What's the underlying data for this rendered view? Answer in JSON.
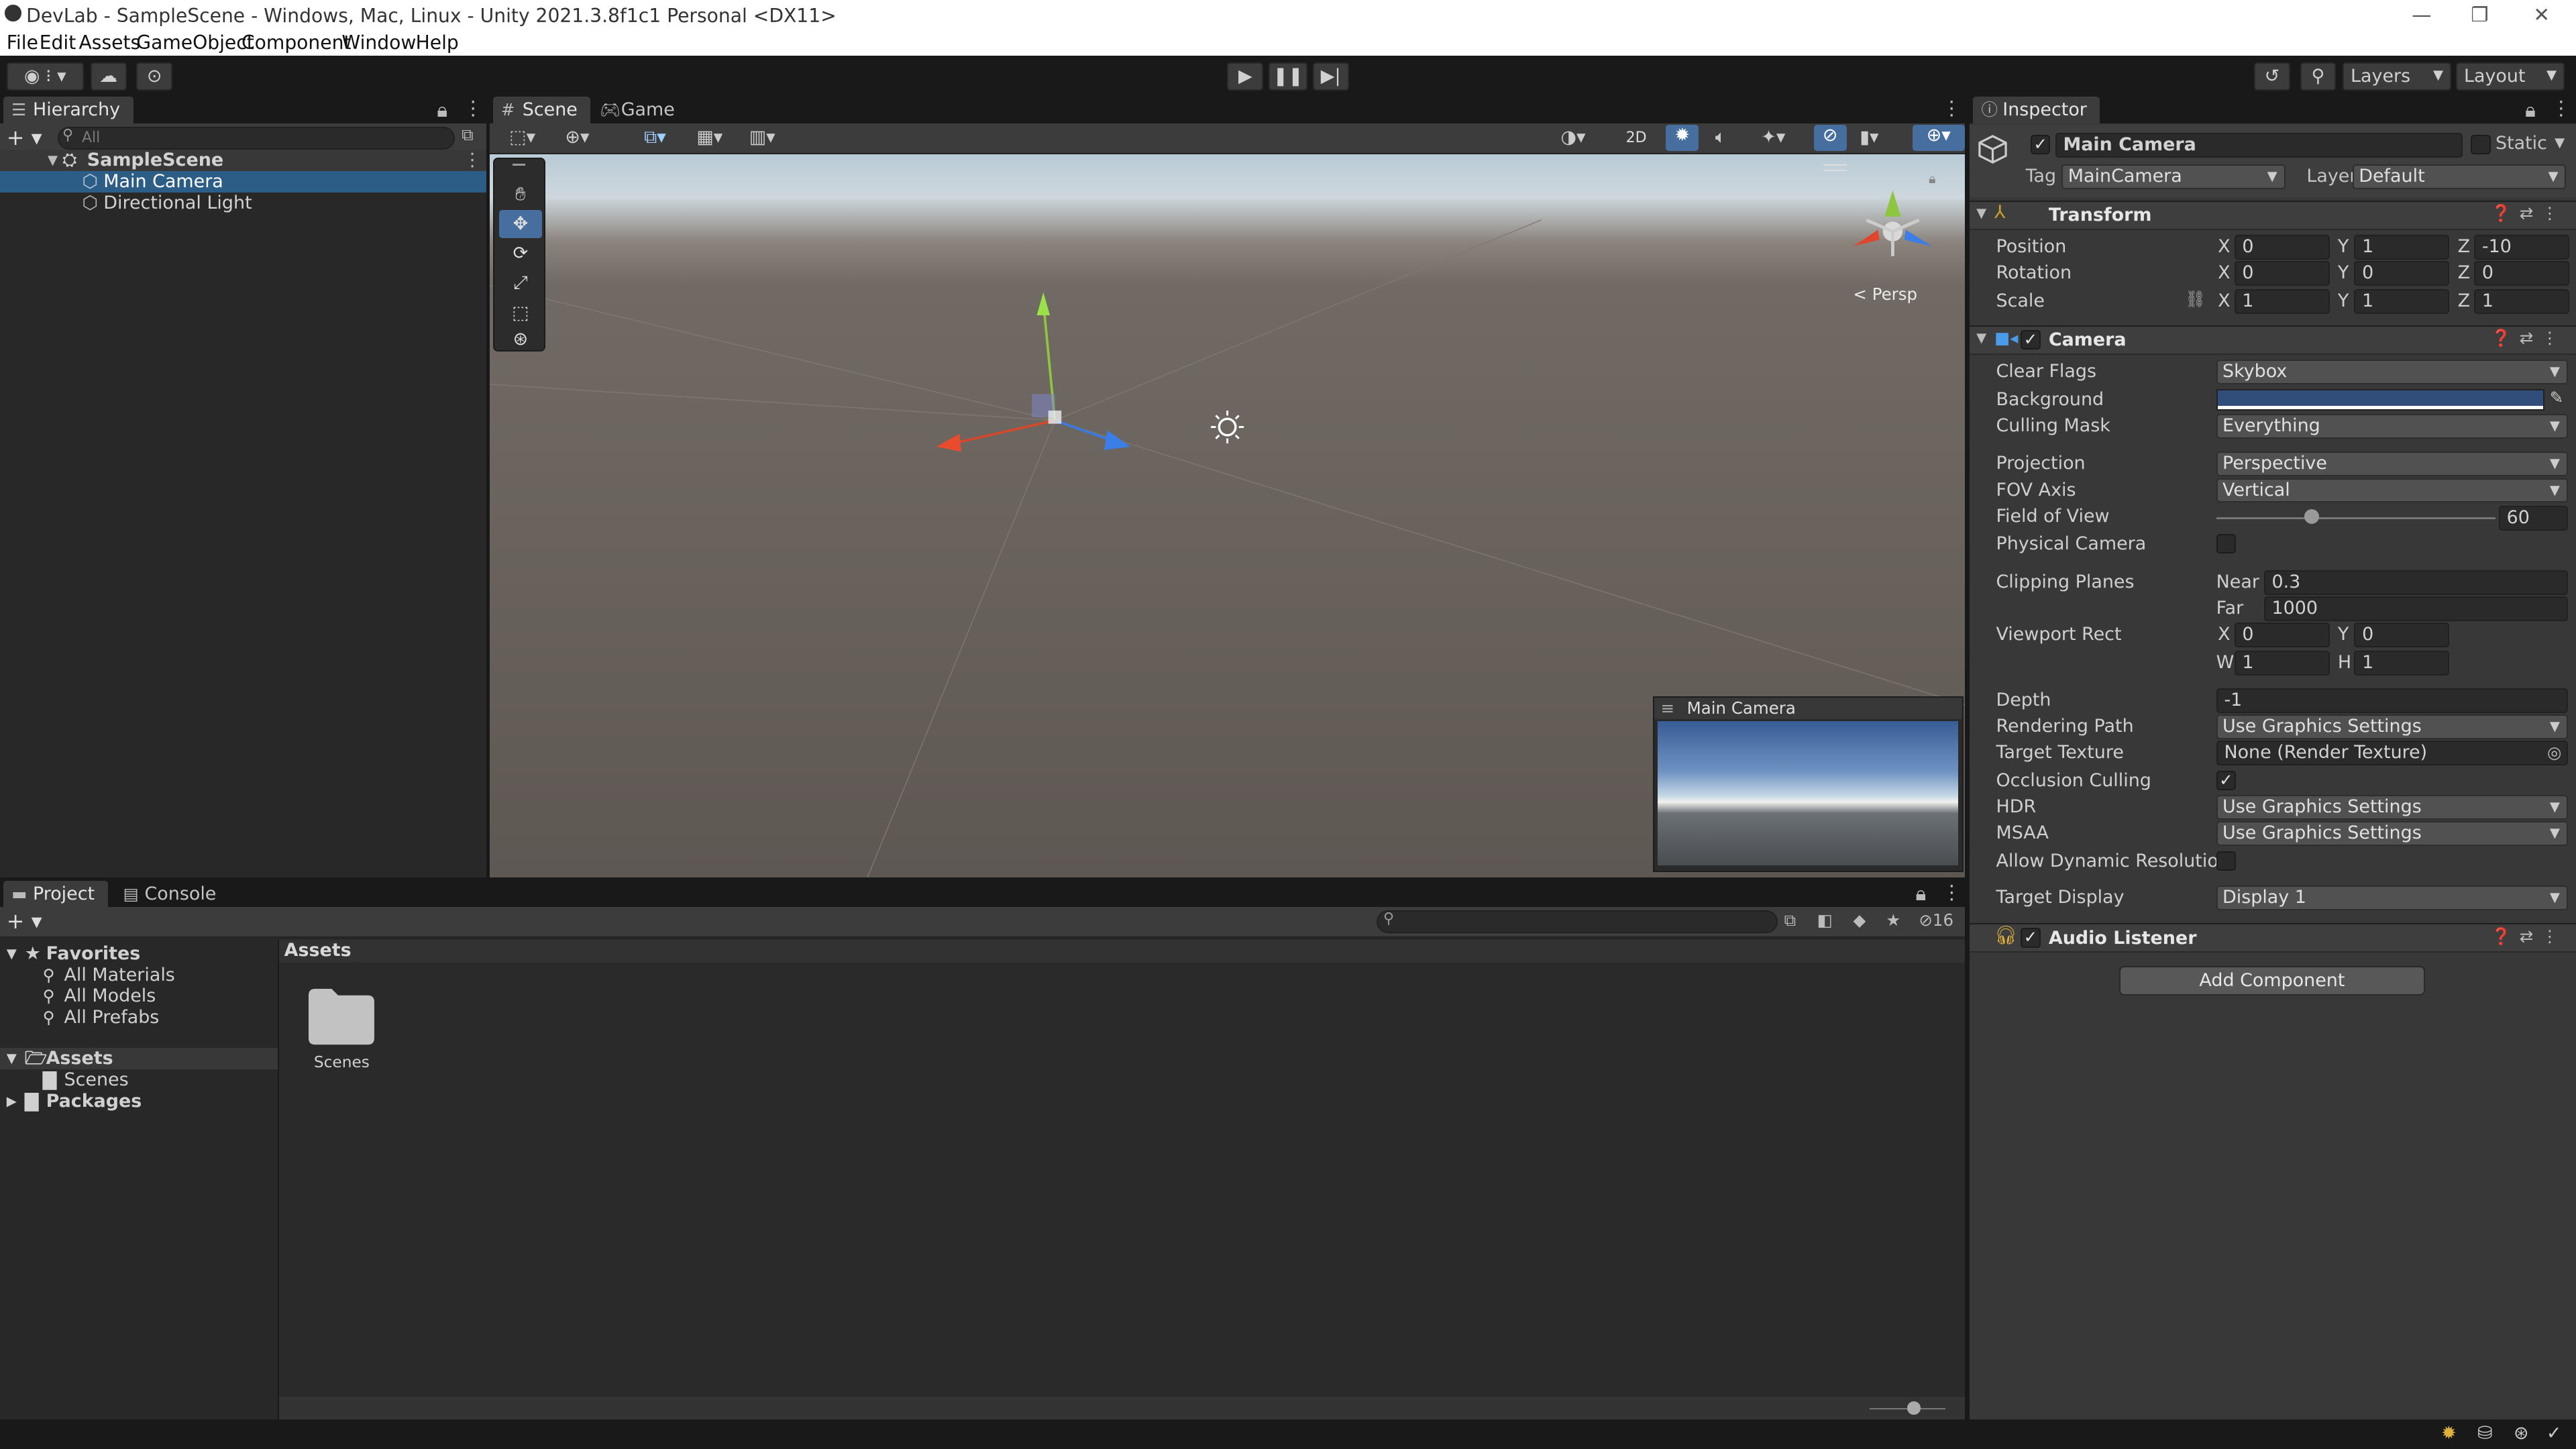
{
  "window": {
    "title": "DevLab - SampleScene - Windows, Mac, Linux - Unity 2021.3.8f1c1 Personal <DX11>"
  },
  "menu": [
    "File",
    "Edit",
    "Assets",
    "GameObject",
    "Component",
    "Window",
    "Help"
  ],
  "toolbar": {
    "layers_label": "Layers",
    "layout_label": "Layout"
  },
  "hierarchy": {
    "tab_label": "Hierarchy",
    "search_placeholder": "All",
    "items": [
      {
        "label": "SampleScene"
      },
      {
        "label": "Main Camera"
      },
      {
        "label": "Directional Light"
      }
    ]
  },
  "scene_view": {
    "tabs": [
      "Scene",
      "Game"
    ],
    "btn_2d": "2D",
    "persp_label": "Persp",
    "camera_preview_title": "Main Camera"
  },
  "inspector": {
    "tab_label": "Inspector",
    "object_name": "Main Camera",
    "static_label": "Static",
    "tag_label": "Tag",
    "tag_value": "MainCamera",
    "layer_label": "Layer",
    "layer_value": "Default",
    "transform": {
      "title": "Transform",
      "position_label": "Position",
      "rotation_label": "Rotation",
      "scale_label": "Scale",
      "position": {
        "x": "0",
        "y": "1",
        "z": "-10"
      },
      "rotation": {
        "x": "0",
        "y": "0",
        "z": "0"
      },
      "scale": {
        "x": "1",
        "y": "1",
        "z": "1"
      }
    },
    "camera": {
      "title": "Camera",
      "clear_flags_label": "Clear Flags",
      "clear_flags": "Skybox",
      "background_label": "Background",
      "background_color": "#314d79",
      "culling_mask_label": "Culling Mask",
      "culling_mask": "Everything",
      "projection_label": "Projection",
      "projection": "Perspective",
      "fov_axis_label": "FOV Axis",
      "fov_axis": "Vertical",
      "fov_label": "Field of View",
      "fov_value": "60",
      "fov_slider_fraction": 0.339,
      "physical_camera_label": "Physical Camera",
      "clipping_label": "Clipping Planes",
      "near_label": "Near",
      "near": "0.3",
      "far_label": "Far",
      "far": "1000",
      "viewport_label": "Viewport Rect",
      "viewport": {
        "x": "0",
        "y": "0",
        "w": "1",
        "h": "1"
      },
      "depth_label": "Depth",
      "depth": "-1",
      "rendering_path_label": "Rendering Path",
      "rendering_path": "Use Graphics Settings",
      "target_texture_label": "Target Texture",
      "target_texture": "None (Render Texture)",
      "occlusion_label": "Occlusion Culling",
      "hdr_label": "HDR",
      "hdr": "Use Graphics Settings",
      "msaa_label": "MSAA",
      "msaa": "Use Graphics Settings",
      "dynamic_res_label": "Allow Dynamic Resolution",
      "target_display_label": "Target Display",
      "target_display": "Display 1"
    },
    "audio_listener": {
      "title": "Audio Listener"
    },
    "add_component_label": "Add Component"
  },
  "project": {
    "tabs": [
      "Project",
      "Console"
    ],
    "hidden_count": "16",
    "favorites_label": "Favorites",
    "favorites": [
      "All Materials",
      "All Models",
      "All Prefabs"
    ],
    "assets_label": "Assets",
    "assets_children": [
      "Scenes"
    ],
    "packages_label": "Packages",
    "breadcrumb": "Assets",
    "files": [
      {
        "name": "Scenes"
      }
    ]
  }
}
